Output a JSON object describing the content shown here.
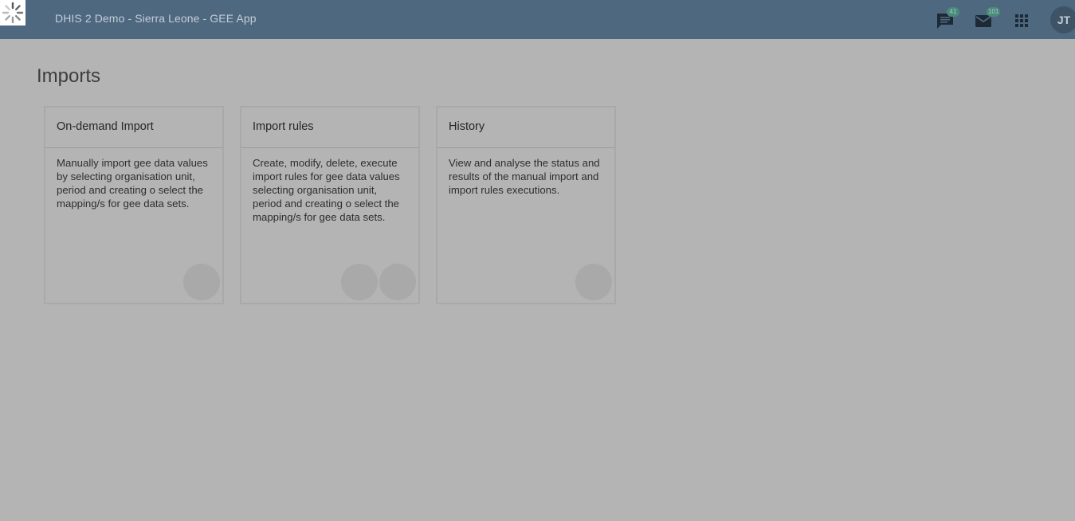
{
  "header": {
    "app_title": "DHIS 2 Demo - Sierra Leone - GEE App",
    "interpretations_count": "41",
    "messages_count": "101",
    "user_initials": "JT"
  },
  "page": {
    "title": "Imports"
  },
  "cards": [
    {
      "title": "On-demand Import",
      "description": "Manually import gee data values by selecting organisation unit, period and creating o select the mapping/s for gee data sets."
    },
    {
      "title": "Import rules",
      "description": "Create, modify, delete, execute import rules for gee data values selecting organisation unit, period and creating o select the mapping/s for gee data sets."
    },
    {
      "title": "History",
      "description": "View and analyse the status and results of the manual import and import rules executions."
    }
  ],
  "icons": {
    "loading": "spinner-icon",
    "interpretations": "chat-icon",
    "messages": "mail-icon",
    "apps": "apps-grid-icon"
  },
  "colors": {
    "header_bg": "#4e6880",
    "overlay_bg": "#b4b4b4",
    "badge_bg": "#4a8a7c"
  }
}
